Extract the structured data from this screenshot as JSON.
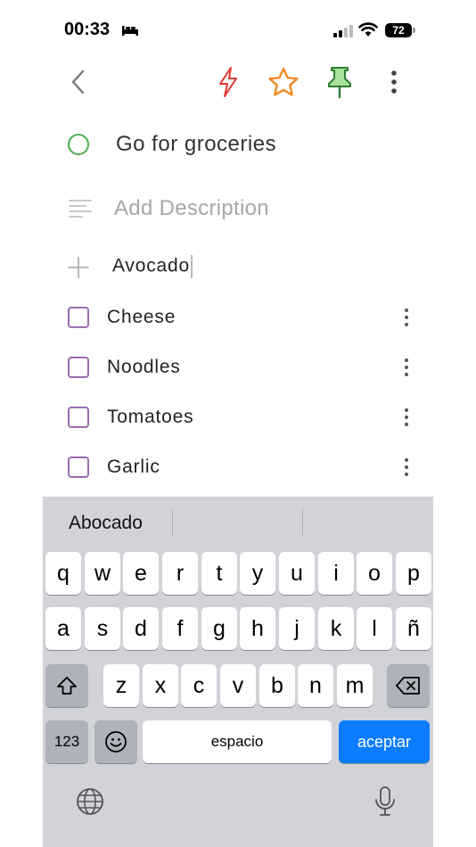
{
  "status": {
    "time": "00:33",
    "battery": "72"
  },
  "task": {
    "title": "Go for groceries",
    "description_placeholder": "Add Description",
    "add_input_value": "Avocado",
    "items": [
      {
        "label": "Cheese"
      },
      {
        "label": "Noodles"
      },
      {
        "label": "Tomatoes"
      },
      {
        "label": "Garlic"
      }
    ]
  },
  "colors": {
    "complete_circle": "#4caf50",
    "checkbox": "#9a6cb0",
    "bolt": "#e53935",
    "star": "#f08a24",
    "pin": "#8bd17a",
    "accept": "#0a7cff"
  },
  "keyboard": {
    "suggestions": [
      "Abocado",
      "",
      ""
    ],
    "row1": [
      "q",
      "w",
      "e",
      "r",
      "t",
      "y",
      "u",
      "i",
      "o",
      "p"
    ],
    "row2": [
      "a",
      "s",
      "d",
      "f",
      "g",
      "h",
      "j",
      "k",
      "l",
      "ñ"
    ],
    "row3": [
      "z",
      "x",
      "c",
      "v",
      "b",
      "n",
      "m"
    ],
    "numbers_label": "123",
    "space_label": "espacio",
    "return_label": "aceptar"
  }
}
